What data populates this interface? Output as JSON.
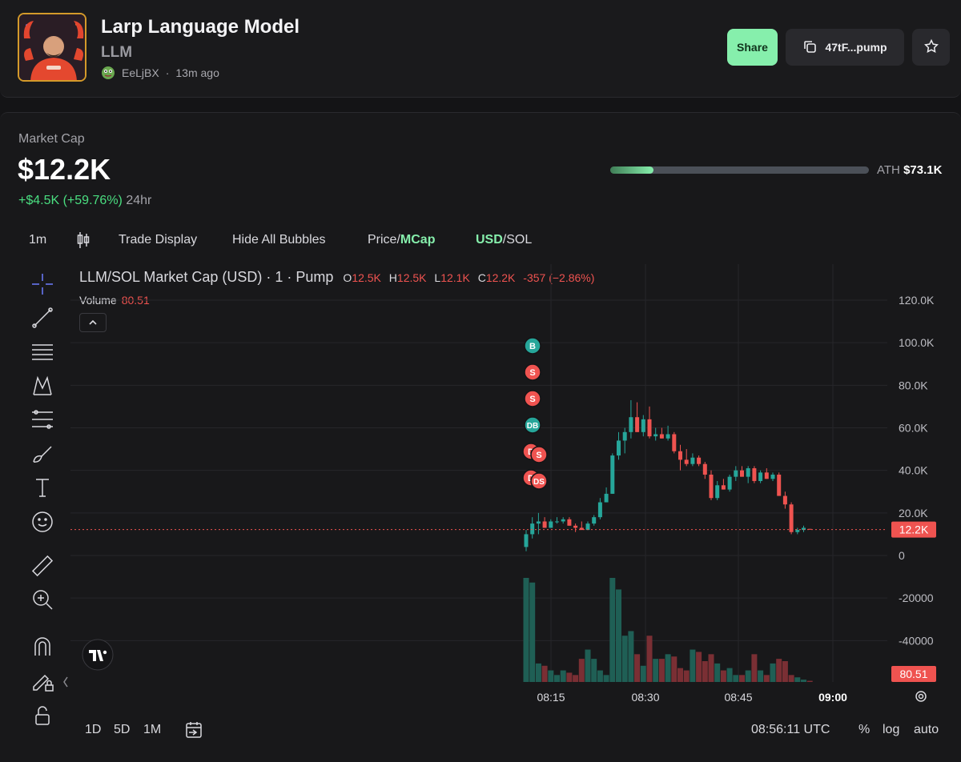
{
  "header": {
    "title": "Larp Language Model",
    "ticker": "LLM",
    "creator": "EeLjBX",
    "age": "13m ago",
    "share_label": "Share",
    "contract_label": "47tF...pump"
  },
  "market": {
    "label": "Market Cap",
    "value": "$12.2K",
    "change": "+$4.5K (+59.76%)",
    "period": "24hr",
    "ath_label": "ATH",
    "ath_value": "$73.1K",
    "ath_progress": 0.167
  },
  "toolbar": {
    "interval": "1m",
    "trade_display": "Trade Display",
    "hide_bubbles": "Hide All Bubbles",
    "price_label": "Price/",
    "mcap_label": "MCap",
    "usd_label": "USD",
    "sol_label": "/SOL"
  },
  "legend": {
    "symbol": "LLM/SOL Market Cap (USD) · 1 · Pump",
    "o_key": "O",
    "o": "12.5K",
    "h_key": "H",
    "h": "12.5K",
    "l_key": "L",
    "l": "12.1K",
    "c_key": "C",
    "c": "12.2K",
    "change": "-357 (−2.86%)",
    "volume_label": "Volume",
    "volume_value": "80.51"
  },
  "chart_data": {
    "type": "candlestick",
    "y_ticks": [
      "120.0K",
      "100.0K",
      "80.0K",
      "60.0K",
      "40.0K",
      "20.0K",
      "0",
      "-20000",
      "-40000"
    ],
    "x_ticks": [
      "08:15",
      "08:30",
      "08:45",
      "09:00"
    ],
    "last_price_label": "12.2K",
    "last_volume_label": "80.51",
    "candles": [
      {
        "o": 4,
        "h": 12,
        "l": 2,
        "c": 10
      },
      {
        "o": 10,
        "h": 18,
        "l": 8,
        "c": 15
      },
      {
        "o": 15,
        "h": 20,
        "l": 10,
        "c": 16
      },
      {
        "o": 16,
        "h": 18,
        "l": 13,
        "c": 13
      },
      {
        "o": 13,
        "h": 17,
        "l": 13,
        "c": 16
      },
      {
        "o": 16,
        "h": 18,
        "l": 15,
        "c": 16
      },
      {
        "o": 16,
        "h": 18,
        "l": 15,
        "c": 17
      },
      {
        "o": 17,
        "h": 18,
        "l": 14,
        "c": 14
      },
      {
        "o": 14,
        "h": 15,
        "l": 11,
        "c": 13
      },
      {
        "o": 13,
        "h": 16,
        "l": 12,
        "c": 12
      },
      {
        "o": 12,
        "h": 16,
        "l": 12,
        "c": 15
      },
      {
        "o": 15,
        "h": 19,
        "l": 14,
        "c": 18
      },
      {
        "o": 18,
        "h": 27,
        "l": 17,
        "c": 25
      },
      {
        "o": 25,
        "h": 32,
        "l": 25,
        "c": 29
      },
      {
        "o": 29,
        "h": 48,
        "l": 29,
        "c": 47
      },
      {
        "o": 47,
        "h": 58,
        "l": 45,
        "c": 54
      },
      {
        "o": 54,
        "h": 60,
        "l": 48,
        "c": 58
      },
      {
        "o": 58,
        "h": 73,
        "l": 55,
        "c": 65
      },
      {
        "o": 65,
        "h": 72,
        "l": 58,
        "c": 58
      },
      {
        "o": 58,
        "h": 66,
        "l": 56,
        "c": 64
      },
      {
        "o": 64,
        "h": 70,
        "l": 55,
        "c": 56
      },
      {
        "o": 56,
        "h": 60,
        "l": 54,
        "c": 57
      },
      {
        "o": 57,
        "h": 60,
        "l": 55,
        "c": 55
      },
      {
        "o": 55,
        "h": 61,
        "l": 54,
        "c": 57
      },
      {
        "o": 57,
        "h": 58,
        "l": 48,
        "c": 49
      },
      {
        "o": 49,
        "h": 52,
        "l": 40,
        "c": 45
      },
      {
        "o": 45,
        "h": 50,
        "l": 42,
        "c": 43
      },
      {
        "o": 43,
        "h": 48,
        "l": 42,
        "c": 46
      },
      {
        "o": 46,
        "h": 47,
        "l": 42,
        "c": 43
      },
      {
        "o": 43,
        "h": 44,
        "l": 36,
        "c": 38
      },
      {
        "o": 38,
        "h": 40,
        "l": 26,
        "c": 27
      },
      {
        "o": 27,
        "h": 35,
        "l": 26,
        "c": 33
      },
      {
        "o": 33,
        "h": 36,
        "l": 31,
        "c": 31
      },
      {
        "o": 31,
        "h": 38,
        "l": 30,
        "c": 37
      },
      {
        "o": 37,
        "h": 42,
        "l": 35,
        "c": 40
      },
      {
        "o": 40,
        "h": 42,
        "l": 37,
        "c": 37
      },
      {
        "o": 37,
        "h": 42,
        "l": 34,
        "c": 41
      },
      {
        "o": 41,
        "h": 42,
        "l": 34,
        "c": 35
      },
      {
        "o": 35,
        "h": 40,
        "l": 34,
        "c": 39
      },
      {
        "o": 39,
        "h": 41,
        "l": 36,
        "c": 36
      },
      {
        "o": 36,
        "h": 39,
        "l": 35,
        "c": 38
      },
      {
        "o": 38,
        "h": 39,
        "l": 28,
        "c": 28
      },
      {
        "o": 28,
        "h": 30,
        "l": 22,
        "c": 24
      },
      {
        "o": 24,
        "h": 25,
        "l": 10,
        "c": 11
      },
      {
        "o": 11,
        "h": 13,
        "l": 10,
        "c": 12
      },
      {
        "o": 12,
        "h": 14,
        "l": 11,
        "c": 13
      },
      {
        "o": 12.5,
        "h": 12.5,
        "l": 12.1,
        "c": 12.2
      }
    ],
    "volumes": [
      45,
      43,
      8,
      7,
      5,
      3,
      5,
      4,
      3,
      10,
      14,
      10,
      5,
      3,
      45,
      40,
      20,
      22,
      12,
      7,
      20,
      10,
      10,
      12,
      11,
      6,
      5,
      14,
      13,
      9,
      12,
      8,
      5,
      6,
      3,
      3,
      5,
      12,
      5,
      3,
      8,
      10,
      9,
      3,
      2,
      1,
      0.5
    ],
    "trade_bubbles": [
      "B",
      "S",
      "S",
      "DB",
      "D",
      "S",
      "D",
      "DS"
    ]
  },
  "bottombar": {
    "range_1d": "1D",
    "range_5d": "5D",
    "range_1m": "1M",
    "time": "08:56:11 UTC",
    "percent": "%",
    "log": "log",
    "auto": "auto"
  },
  "colors": {
    "up": "#26a69a",
    "down": "#ef5350",
    "accent": "#86efac"
  }
}
